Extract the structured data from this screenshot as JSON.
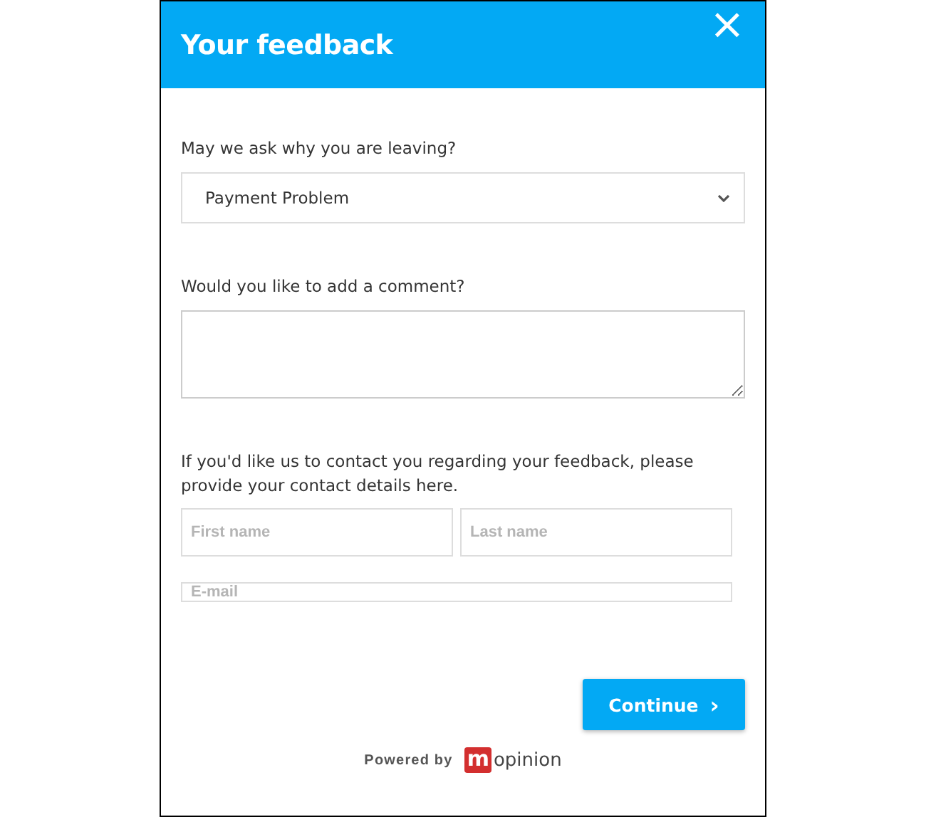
{
  "dialog": {
    "title": "Your feedback",
    "close": "×"
  },
  "questions": [
    {
      "kind": "select",
      "label": "May we ask why you are leaving?",
      "value": "Payment Problem"
    },
    {
      "kind": "textarea",
      "label": "Would you like to add a comment?"
    },
    {
      "kind": "contact",
      "label": "If you'd like us to contact you regarding your feedback, please provide your contact details here.",
      "fields": [
        {
          "placeholder": "First name"
        },
        {
          "placeholder": "Last name"
        },
        {
          "placeholder": "E-mail"
        }
      ]
    }
  ],
  "continue_button": {
    "label": "Continue",
    "icon": "›"
  },
  "footer": {
    "powered_by": "Powered by",
    "logo_mark": "m",
    "logo_text": "opinion"
  }
}
